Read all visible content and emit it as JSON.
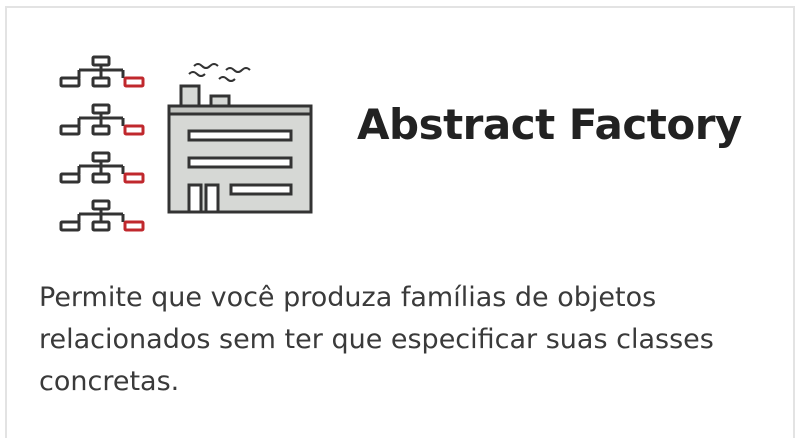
{
  "card": {
    "title": "Abstract Factory",
    "description": "Permite que você produza famílias de objetos relacionados sem ter que especificar suas classes concretas."
  },
  "icons": {
    "hierarchy": "class-hierarchy-icon",
    "factory": "factory-icon"
  },
  "colors": {
    "accent": "#c0282d",
    "outline": "#333333",
    "factory_fill": "#d6d8d5",
    "title": "#222222",
    "text": "#3a3a3a",
    "border": "#e3e3e3"
  }
}
